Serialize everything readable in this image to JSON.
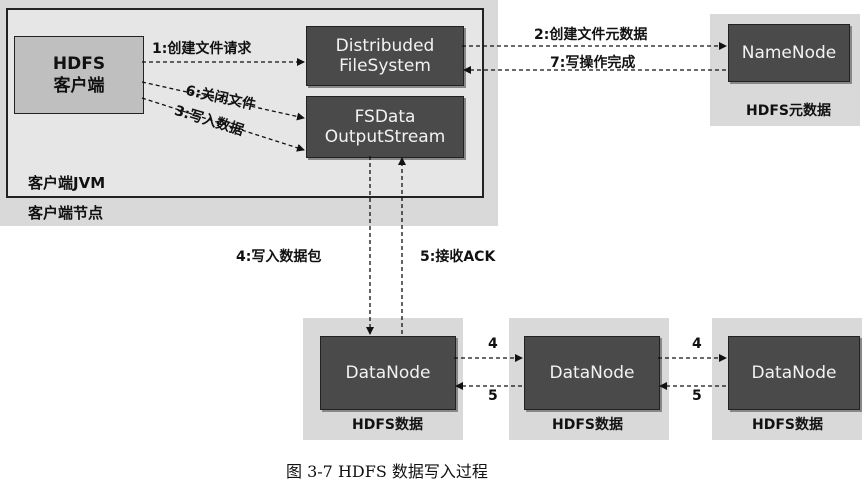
{
  "client": {
    "title_line1": "HDFS",
    "title_line2": "客户端",
    "jvm_label": "客户端JVM",
    "node_label": "客户端节点"
  },
  "boxes": {
    "dfs_line1": "Distribuded",
    "dfs_line2": "FileSystem",
    "fsdos_line1": "FSData",
    "fsdos_line2": "OutputStream",
    "namenode": "NameNode",
    "datanode1": "DataNode",
    "datanode2": "DataNode",
    "datanode3": "DataNode"
  },
  "captions": {
    "namenode_meta": "HDFS元数据",
    "dn1_data": "HDFS数据",
    "dn2_data": "HDFS数据",
    "dn3_data": "HDFS数据"
  },
  "steps": {
    "s1": "1:创建文件请求",
    "s2": "2:创建文件元数据",
    "s3": "3:写入数据",
    "s4": "4:写入数据包",
    "s5": "5:接收ACK",
    "s6": "6:关闭文件",
    "s7": "7:写操作完成",
    "pipe_4a": "4",
    "pipe_5a": "5",
    "pipe_4b": "4",
    "pipe_5b": "5"
  },
  "figure_caption": "图 3-7   HDFS 数据写入过程"
}
